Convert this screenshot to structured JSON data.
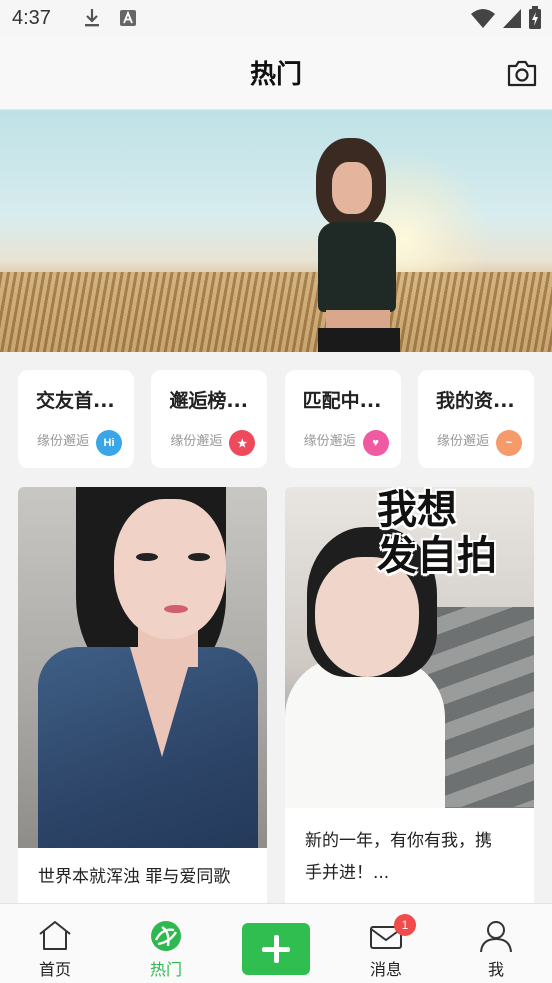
{
  "status_bar": {
    "time": "4:37",
    "icons": [
      "download-icon",
      "keyboard-a-icon",
      "wifi-icon",
      "signal-icon",
      "battery-charging-icon"
    ]
  },
  "header": {
    "title": "热门",
    "camera_icon": "camera-icon"
  },
  "categories": [
    {
      "title": "交友首...",
      "subtitle": "缘份邂逅",
      "badge": "Hi",
      "badge_color": "#3aa6e8",
      "icon": "hi-chat-icon"
    },
    {
      "title": "邂逅榜...",
      "subtitle": "缘份邂逅",
      "badge": "★",
      "badge_color": "#ee4a5c",
      "icon": "star-badge-icon"
    },
    {
      "title": "匹配中...",
      "subtitle": "缘份邂逅",
      "badge": "♥",
      "badge_color": "#f05aa3",
      "icon": "hearts-icon"
    },
    {
      "title": "我的资...",
      "subtitle": "缘份邂逅",
      "badge": "~",
      "badge_color": "#f59a6a",
      "icon": "profile-card-icon"
    }
  ],
  "feed": [
    {
      "caption": "世界本就浑浊 罪与爱同歌"
    },
    {
      "caption_line1": "新的一年，有你有我，携",
      "caption_line2": "手并进！...",
      "sticker_line1": "我想",
      "sticker_line2": "发自拍"
    }
  ],
  "bottom_nav": {
    "items": [
      {
        "label": "首页",
        "icon": "home-icon"
      },
      {
        "label": "热门",
        "icon": "hot-icon",
        "active": true
      },
      {
        "label": "",
        "icon": "plus-icon"
      },
      {
        "label": "消息",
        "icon": "mail-icon",
        "badge": "1"
      },
      {
        "label": "我",
        "icon": "user-icon"
      }
    ],
    "accent_color": "#2fbe4f"
  }
}
